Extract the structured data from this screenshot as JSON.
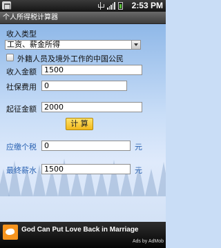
{
  "status_bar": {
    "time": "2:53 PM"
  },
  "app": {
    "title": "个人所得税计算器"
  },
  "form": {
    "income_type_label": "收入类型",
    "income_type_value": "工资、薪金所得",
    "foreign_checkbox_label": "外籍人员及境外工作的中国公民",
    "foreign_checked": false,
    "income_amount_label": "收入金额",
    "income_amount_value": "1500",
    "social_security_label": "社保费用",
    "social_security_value": "0",
    "threshold_label": "起征金额",
    "threshold_value": "2000",
    "calculate_label": "计 算",
    "tax_payable_label": "应缴个税",
    "tax_payable_value": "0",
    "tax_payable_unit": "元",
    "final_salary_label": "最终薪水",
    "final_salary_value": "1500",
    "final_salary_unit": "元"
  },
  "ad": {
    "text": "God Can Put Love Back in Marriage",
    "by": "Ads by AdMob"
  },
  "colors": {
    "label_accent": "#2b63b3",
    "button": "#f5c52a",
    "battery": "#57c234"
  }
}
